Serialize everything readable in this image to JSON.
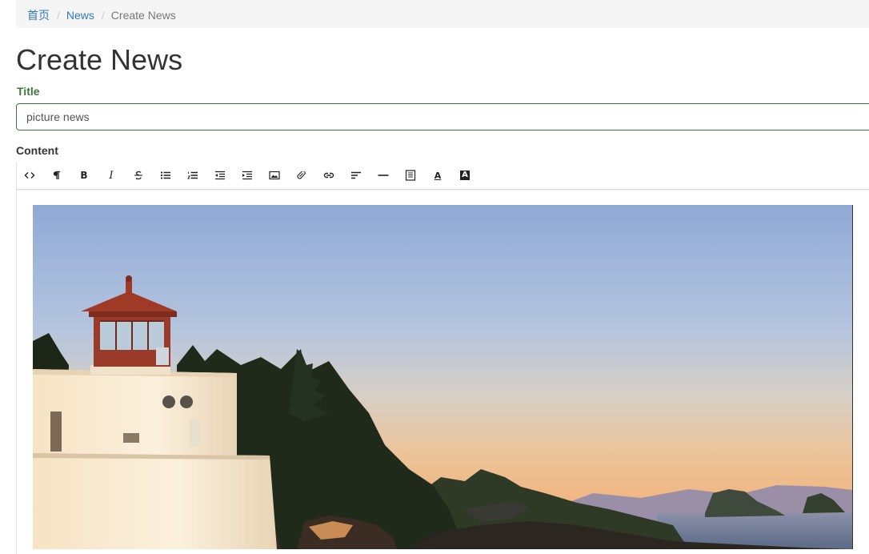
{
  "breadcrumb": {
    "items": [
      {
        "label": "首页",
        "link": true
      },
      {
        "label": "News",
        "link": true
      },
      {
        "label": "Create News",
        "link": false
      }
    ],
    "separator": "/"
  },
  "page": {
    "title": "Create News"
  },
  "form": {
    "title_label": "Title",
    "title_value": "picture news",
    "content_label": "Content"
  },
  "toolbar": {
    "buttons": [
      {
        "name": "html-source-icon"
      },
      {
        "name": "paragraph-icon"
      },
      {
        "name": "bold-icon",
        "glyph": "B"
      },
      {
        "name": "italic-icon",
        "glyph": "I"
      },
      {
        "name": "strikethrough-icon"
      },
      {
        "name": "unordered-list-icon"
      },
      {
        "name": "ordered-list-icon"
      },
      {
        "name": "outdent-icon"
      },
      {
        "name": "indent-icon"
      },
      {
        "name": "image-icon"
      },
      {
        "name": "video-icon"
      },
      {
        "name": "link-icon"
      },
      {
        "name": "align-icon"
      },
      {
        "name": "horizontal-rule-icon"
      },
      {
        "name": "fullscreen-icon"
      },
      {
        "name": "font-color-icon",
        "glyph": "A"
      },
      {
        "name": "background-color-icon",
        "glyph": "A"
      }
    ]
  },
  "editor": {
    "image": {
      "subject": "lighthouse-at-sunset"
    }
  },
  "colors": {
    "link": "#337ab7",
    "success": "#3c763d",
    "breadcrumb_bg": "#f5f5f5"
  }
}
